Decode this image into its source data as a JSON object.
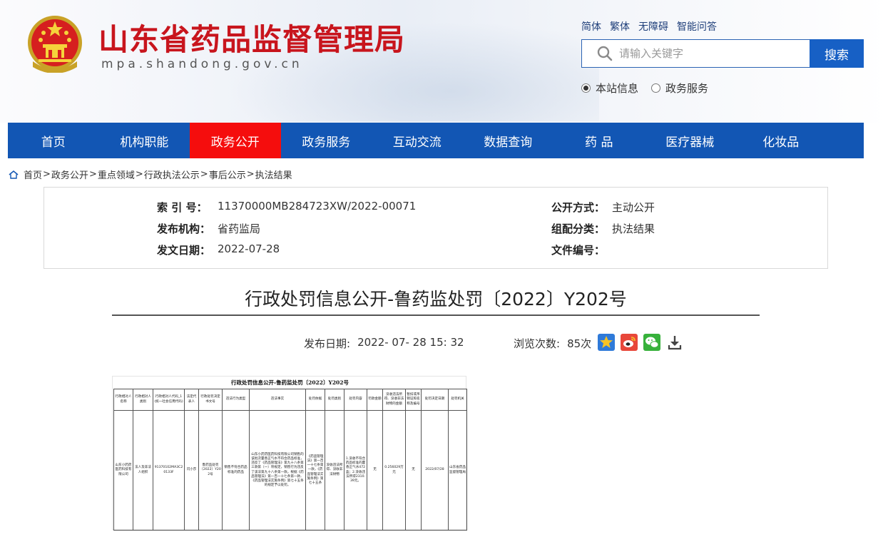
{
  "header": {
    "title": "山东省药品监督管理局",
    "domain": "mpa.shandong.gov.cn",
    "top_links": [
      "简体",
      "繁体",
      "无障碍",
      "智能问答"
    ],
    "search_placeholder": "请输入关键字",
    "search_button": "搜索",
    "scope_options": [
      {
        "label": "本站信息",
        "checked": true
      },
      {
        "label": "政务服务",
        "checked": false
      }
    ]
  },
  "nav": {
    "items": [
      "首页",
      "机构职能",
      "政务公开",
      "政务服务",
      "互动交流",
      "数据查询",
      "药 品",
      "医疗器械",
      "化妆品"
    ],
    "active": "政务公开",
    "active_color": "#f50d0d",
    "bar_color": "#1256b4"
  },
  "breadcrumb": [
    "首页",
    "政务公开",
    "重点领域",
    "行政执法公示",
    "事后公示",
    "执法结果"
  ],
  "meta": {
    "index_label": "索 引 号：",
    "index_value": "11370000MB284723XW/2022-00071",
    "org_label": "发布机构：",
    "org_value": "省药监局",
    "date_label": "发文日期：",
    "date_value": "2022-07-28",
    "mode_label": "公开方式：",
    "mode_value": "主动公开",
    "category_label": "组配分类：",
    "category_value": "执法结果",
    "docno_label": "文件编号：",
    "docno_value": ""
  },
  "article": {
    "title": "行政处罚信息公开-鲁药监处罚〔2022〕Y202号",
    "pub_label": "发布日期:",
    "pub_value": "2022- 07- 28 15: 32",
    "views_label": "浏览次数:",
    "views_value": "85次",
    "share_icons": [
      "favorite-icon",
      "weibo-icon",
      "wechat-icon",
      "download-icon"
    ]
  },
  "document": {
    "title": "行政处罚信息公开-鲁药监处罚〔2022〕Y202号",
    "headers": [
      "行政相对人名称",
      "行政相对人类别",
      "行政相对人代码_1(统一社会信用代码)",
      "法定代表人",
      "行政处罚决定书文号",
      "违法行为类型",
      "违法事实",
      "处罚依据",
      "处罚类别",
      "处罚内容",
      "罚款金额",
      "没收违法所得、没收非法财物的金额",
      "暂扣或吊销证照名称及编号",
      "处罚决定日期",
      "处罚机关"
    ],
    "row": [
      "山东小药药医药科技有限公司",
      "法人及非法人组织",
      "91370102MA3C20133F",
      "闫小莎",
      "鲁药监处罚〔2022〕Y202号",
      "销售不符合药品标准的药品",
      "山东小药药医药科技有限公司销售的该批次藿香正气水不符合药品标准，违反了《药品管理法》第九十八条第三款第（一）项规定，销售行为违反了该法第九十八条第一款。根据《药品管理法》第一百一十七条第一款、《药品管理法实施条例》第七十五条的规定予以处罚。",
      "《药品管理法》第一百一十七条第一款，《药品管理法实施条例》第七十五条",
      "没收违法所得、没收非法财物",
      "1.没收不符合药品标准的藿香正气水472盒；2.没收违法所得2310.39元。",
      "无",
      "0.256029万元",
      "无",
      "2022/07/28",
      "山东省药品监督管理局"
    ]
  }
}
